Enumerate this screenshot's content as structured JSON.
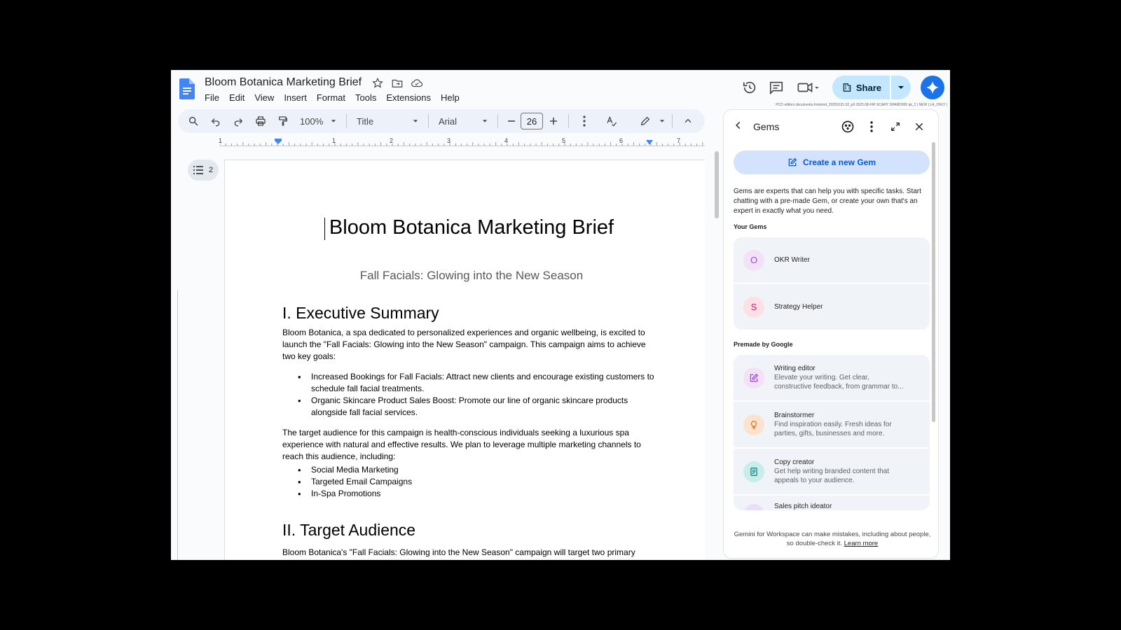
{
  "doc": {
    "title": "Bloom Botanica Marketing Brief",
    "menu": [
      "File",
      "Edit",
      "View",
      "Insert",
      "Format",
      "Tools",
      "Extensions",
      "Help"
    ]
  },
  "header": {
    "share_label": "Share",
    "build_info": "PCO editors.documents.frontend_20250131.02_p0 2025.08-FRI SCARY SHARD000 qk_2 | NEW | LA_ONLY |"
  },
  "toolbar": {
    "zoom": "100%",
    "style": "Title",
    "font": "Arial",
    "font_size": "26"
  },
  "ruler": {
    "numbers": [
      "1",
      "1",
      "2",
      "3",
      "4",
      "5",
      "6",
      "7"
    ]
  },
  "outline": {
    "count": "2"
  },
  "content": {
    "title": "Bloom Botanica Marketing Brief",
    "subtitle": "Fall Facials: Glowing into the New Season",
    "h1_exec": "I. Executive Summary",
    "p1": "Bloom Botanica, a spa dedicated to personalized experiences and organic wellbeing, is excited to launch the \"Fall Facials: Glowing into the New Season\" campaign. This campaign aims to achieve two key goals:",
    "goals": [
      "Increased Bookings for Fall Facials: Attract new clients and encourage existing customers to schedule fall facial treatments.",
      "Organic Skincare Product Sales Boost:  Promote our line of organic skincare products alongside fall facial services."
    ],
    "p2": "The target audience for this campaign is health-conscious individuals seeking a luxurious spa experience with natural and effective results. We plan to leverage multiple marketing channels to reach this audience, including:",
    "channels": [
      "Social Media Marketing",
      "Targeted Email Campaigns",
      "In-Spa Promotions"
    ],
    "h1_target": "II. Target Audience",
    "p3": "Bloom Botanica's \"Fall Facials: Glowing into the New Season\" campaign will target two primary"
  },
  "gems_panel": {
    "title": "Gems",
    "create_label": "Create a new Gem",
    "description": "Gems are experts that can help you with specific tasks. Start chatting with a pre-made Gem, or create your own that's an expert in exactly what you need.",
    "your_gems_label": "Your Gems",
    "your_gems": [
      {
        "initial": "O",
        "name": "OKR Writer",
        "color": "#f3e1f7",
        "text_color": "#a142f4"
      },
      {
        "initial": "S",
        "name": "Strategy Helper",
        "color": "#fde0e4",
        "text_color": "#d01884"
      }
    ],
    "premade_label": "Premade by Google",
    "premade": [
      {
        "name": "Writing editor",
        "desc1": "Elevate your writing. Get clear,",
        "desc2": "constructive feedback, from grammar to...",
        "icon": "edit-note-icon",
        "color": "#f3e1f7"
      },
      {
        "name": "Brainstormer",
        "desc1": "Find inspiration easily. Fresh ideas for",
        "desc2": "parties, gifts, businesses and more.",
        "icon": "lightbulb-icon",
        "color": "#fde3cf"
      },
      {
        "name": "Copy creator",
        "desc1": "Get help writing branded content that",
        "desc2": "appeals to your audience.",
        "icon": "document-icon",
        "color": "#c9ede8"
      },
      {
        "name": "Sales pitch ideator",
        "desc1": "",
        "desc2": "",
        "icon": "sales-icon",
        "color": "#e8e0fb"
      }
    ],
    "footer_text": "Gemini for Workspace can make mistakes, including about people, so double-check it.",
    "learn_more": "Learn more"
  }
}
